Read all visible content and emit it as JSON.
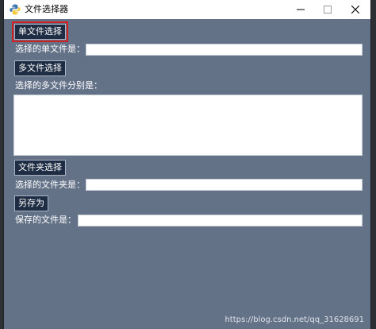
{
  "window": {
    "title": "文件选择器"
  },
  "icons": {
    "app": "python-logo-icon",
    "minimize": "minimize-icon",
    "maximize": "maximize-icon",
    "close": "close-icon"
  },
  "colors": {
    "client_background": "#647288",
    "button_background": "#1e2d44",
    "selection_outline": "#d21f1f"
  },
  "form": {
    "single_file": {
      "button_label": "单文件选择",
      "field_label": "选择的单文件是：",
      "value": ""
    },
    "multi_file": {
      "button_label": "多文件选择",
      "field_label": "选择的多文件分别是：",
      "value": ""
    },
    "folder": {
      "button_label": "文件夹选择",
      "field_label": "选择的文件夹是：",
      "value": ""
    },
    "save_as": {
      "button_label": "另存为",
      "field_label": "保存的文件是：",
      "value": ""
    }
  },
  "watermark": "https://blog.csdn.net/qq_31628691"
}
